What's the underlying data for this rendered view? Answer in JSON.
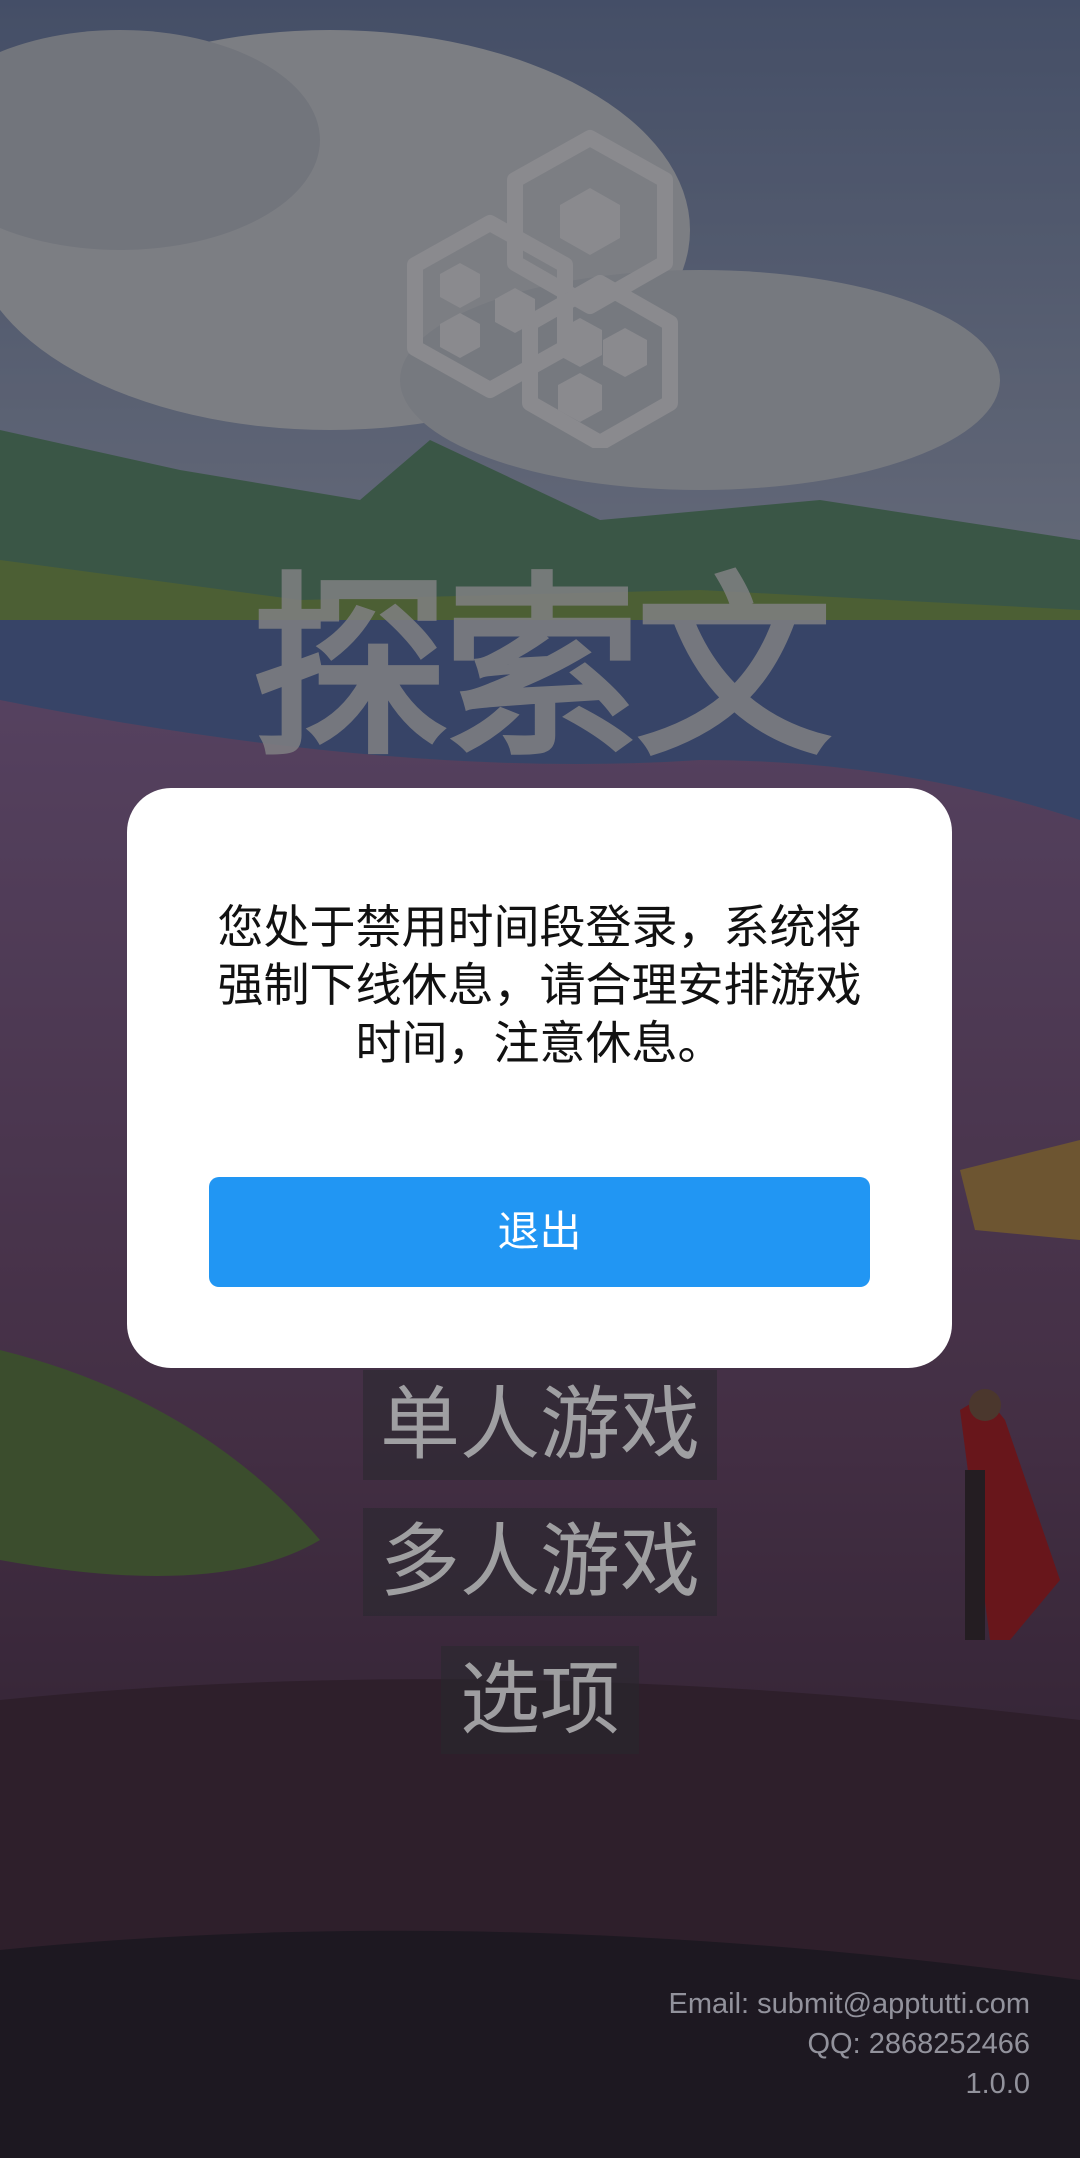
{
  "game": {
    "title": "探索文明",
    "logo_icon": "hexagon-cluster-logo"
  },
  "menu": {
    "single_player": "单人游戏",
    "multi_player": "多人游戏",
    "options": "选项"
  },
  "footer": {
    "email": "Email: submit@apptutti.com",
    "qq": "QQ: 2868252466",
    "version": "1.0.0"
  },
  "dialog": {
    "message": "您处于禁用时间段登录，系统将强制下线休息，请合理安排游戏时间，注意休息。",
    "exit_label": "退出"
  },
  "colors": {
    "accent": "#2196f3",
    "dialog_bg": "#ffffff",
    "overlay": "rgba(0,0,0,0.38)"
  }
}
